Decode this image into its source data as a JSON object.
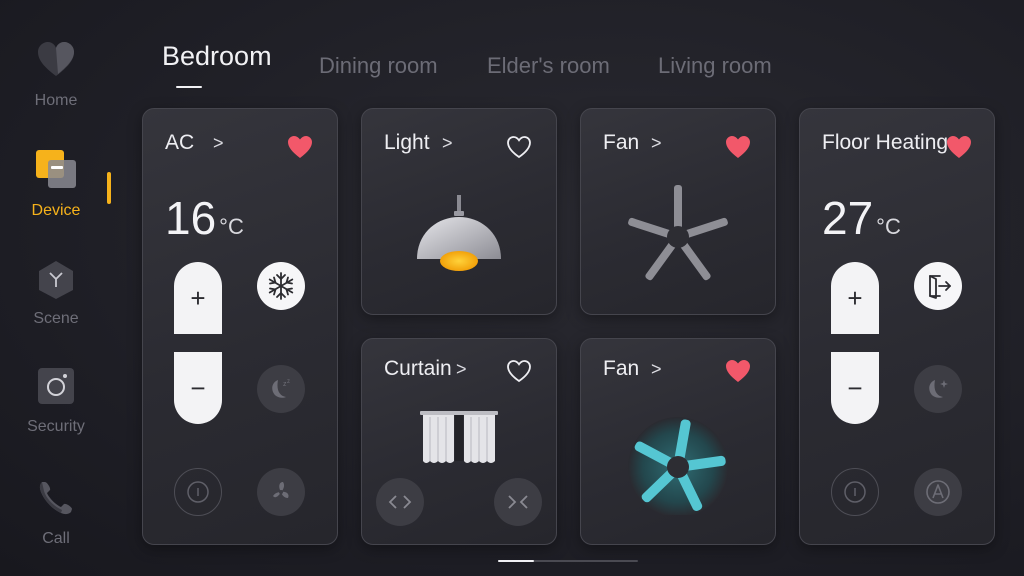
{
  "nav": [
    {
      "label": "Home",
      "icon": "heart-home-icon"
    },
    {
      "label": "Device",
      "icon": "device-icon",
      "active": true
    },
    {
      "label": "Scene",
      "icon": "scene-icon"
    },
    {
      "label": "Security",
      "icon": "camera-icon"
    },
    {
      "label": "Call",
      "icon": "phone-icon"
    }
  ],
  "tabs": [
    "Bedroom",
    "Dining room",
    "Elder's room",
    "Living room"
  ],
  "active_tab": "Bedroom",
  "cards": {
    "ac": {
      "title": "AC",
      "chevron": ">",
      "favorite": true,
      "temperature": "16",
      "unit": "°C",
      "plus": "+",
      "minus": "−"
    },
    "light": {
      "title": "Light",
      "chevron": ">",
      "favorite": false
    },
    "fan1": {
      "title": "Fan",
      "chevron": ">",
      "favorite": true
    },
    "floor": {
      "title": "Floor Heating",
      "favorite": true,
      "temperature": "27",
      "unit": "°C",
      "plus": "+",
      "minus": "−"
    },
    "curtain": {
      "title": "Curtain",
      "chevron": ">",
      "favorite": false
    },
    "fan2": {
      "title": "Fan",
      "chevron": ">",
      "favorite": true
    }
  },
  "colors": {
    "accent": "#f6b21b",
    "heart": "#f2586a",
    "fan_active": "#4fc3cf",
    "background": "#1f1f26"
  },
  "scroll_indicator_fraction": 0.26
}
